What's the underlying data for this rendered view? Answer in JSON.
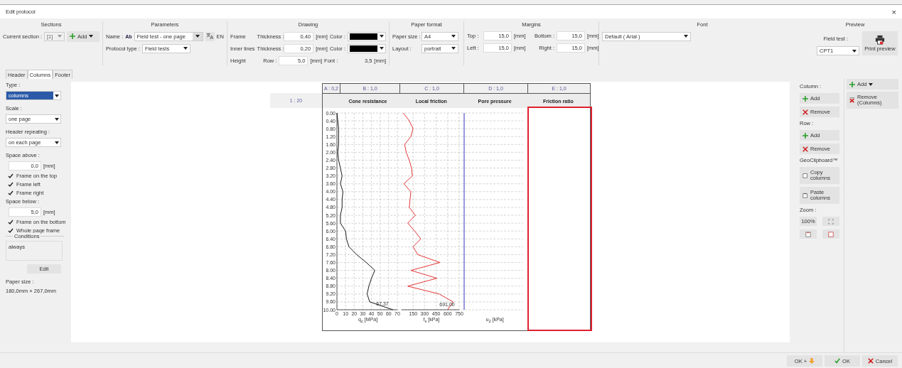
{
  "window": {
    "title": "Edit protocol",
    "close": "×"
  },
  "sections": {
    "title": "Sections",
    "current_label": "Current section :",
    "current_value": "[1]",
    "add": "Add"
  },
  "parameters": {
    "title": "Parameters",
    "name_label": "Name :",
    "name_badge": "Ab",
    "name_value": "Field test - one page",
    "language": "EN",
    "type_label": "Protocol type :",
    "type_value": "Field tests"
  },
  "drawing": {
    "title": "Drawing",
    "rows": [
      {
        "label": "Frame",
        "thickness_label": "Thickness :",
        "thickness": "0,40",
        "unit": "[mm]",
        "color_label": "Color :",
        "color": "#000000"
      },
      {
        "label": "Inner lines",
        "thickness_label": "Thickness :",
        "thickness": "0,20",
        "unit": "[mm]",
        "color_label": "Color :",
        "color": "#000000"
      }
    ],
    "height_label": "Height",
    "row_label": "Row :",
    "row": "5,0",
    "row_unit": "[mm]",
    "font_label": "Font :",
    "font": "3,5",
    "font_unit": "[mm]"
  },
  "paper_format": {
    "title": "Paper format",
    "size_label": "Paper size :",
    "size": "A4",
    "layout_label": "Layout :",
    "layout": "portrait"
  },
  "margins": {
    "title": "Margins",
    "fields": [
      {
        "label": "Top :",
        "value": "15,0",
        "unit": "[mm]"
      },
      {
        "label": "Bottom :",
        "value": "15,0",
        "unit": "[mm]"
      },
      {
        "label": "Left :",
        "value": "15,0",
        "unit": "[mm]"
      },
      {
        "label": "Right :",
        "value": "15,0",
        "unit": "[mm]"
      }
    ]
  },
  "font": {
    "title": "Font",
    "value": "Default ( Arial )"
  },
  "preview_group": {
    "title": "Preview",
    "field_test_label": "Field test :",
    "field_test": "CPT1",
    "print": "Print preview"
  },
  "tabs": [
    {
      "label": "Header",
      "selected": false
    },
    {
      "label": "Columns",
      "selected": true
    },
    {
      "label": "Footer",
      "selected": false
    }
  ],
  "left_panel": [
    {
      "kind": "label",
      "text": "Type :"
    },
    {
      "kind": "select",
      "value": "columns",
      "highlighted": true
    },
    {
      "kind": "label",
      "text": "Scale :"
    },
    {
      "kind": "select",
      "value": "one page",
      "highlighted": false
    },
    {
      "kind": "label",
      "text": "Header repeating :"
    },
    {
      "kind": "select",
      "value": "on each page",
      "highlighted": false
    },
    {
      "kind": "label",
      "text": "Space above :"
    },
    {
      "kind": "number",
      "value": "0,0",
      "unit": "[mm]"
    },
    {
      "kind": "checkbox",
      "label": "Frame on the top",
      "checked": true
    },
    {
      "kind": "checkbox",
      "label": "Frame left",
      "checked": true
    },
    {
      "kind": "checkbox",
      "label": "Frame right",
      "checked": true
    },
    {
      "kind": "label",
      "text": "Space below :"
    },
    {
      "kind": "number",
      "value": "5,0",
      "unit": "[mm]"
    },
    {
      "kind": "checkbox",
      "label": "Frame on the bottom",
      "checked": true
    },
    {
      "kind": "checkbox",
      "label": "Whole page frame",
      "checked": true
    },
    {
      "kind": "group",
      "title": "Conditions",
      "value": "always"
    },
    {
      "kind": "button",
      "label": "Edit"
    },
    {
      "kind": "label",
      "text": "Paper size :"
    },
    {
      "kind": "text",
      "text": "180,0mm × 267,0mm"
    }
  ],
  "preview": {
    "scale": "1 : 20",
    "column_tags": [
      "A : 0,2",
      "B : 1,0",
      "C : 1,0",
      "D : 1,0",
      "E : 1,0"
    ],
    "columns": [
      {
        "selected": false,
        "chart_data": {
          "type": "line",
          "orientation": "horizontal",
          "title": "Cone resistance",
          "xlabel": "q$_{c}$ [MPa]",
          "x": [
            0,
            0.4,
            0.8,
            1.2,
            1.6,
            2.0,
            2.4,
            2.8,
            3.2,
            3.6,
            4.0,
            4.4,
            4.8,
            5.2,
            5.6,
            6.0,
            6.4,
            6.8,
            7.2,
            7.6,
            8.0,
            8.4,
            8.8,
            9.2,
            9.6,
            10.0
          ],
          "xlim": [
            0,
            70
          ],
          "ylim": [
            10,
            0
          ],
          "yticks": [
            {
              "value": 0,
              "label": "0.00"
            },
            {
              "value": 0.4,
              "label": "0.40"
            },
            {
              "value": 0.8,
              "label": "0.80"
            },
            {
              "value": 1.2,
              "label": "1.20"
            },
            {
              "value": 1.6,
              "label": "1.60"
            },
            {
              "value": 2.0,
              "label": "2.00"
            },
            {
              "value": 2.4,
              "label": "2.40"
            },
            {
              "value": 2.8,
              "label": "2.80"
            },
            {
              "value": 3.2,
              "label": "3.20"
            },
            {
              "value": 3.6,
              "label": "3.60"
            },
            {
              "value": 4.0,
              "label": "4.00"
            },
            {
              "value": 4.4,
              "label": "4.40"
            },
            {
              "value": 4.8,
              "label": "4.80"
            },
            {
              "value": 5.2,
              "label": "5.20"
            },
            {
              "value": 5.6,
              "label": "5.60"
            },
            {
              "value": 6.0,
              "label": "6.00"
            },
            {
              "value": 6.4,
              "label": "6.40"
            },
            {
              "value": 6.8,
              "label": "6.80"
            },
            {
              "value": 7.2,
              "label": "7.20"
            },
            {
              "value": 7.6,
              "label": "7.60"
            },
            {
              "value": 8.0,
              "label": "8.00"
            },
            {
              "value": 8.4,
              "label": "8.40"
            },
            {
              "value": 8.8,
              "label": "8.80"
            },
            {
              "value": 9.2,
              "label": "9.20"
            },
            {
              "value": 9.6,
              "label": "9.60"
            },
            {
              "value": 10.0,
              "label": "10.00"
            }
          ],
          "xticks": [
            0,
            10,
            20,
            30,
            40,
            50,
            60,
            70
          ],
          "series": [
            {
              "color": "#000000",
              "values": [
                0,
                1,
                2,
                2,
                2,
                1,
                2,
                4,
                6,
                4,
                7,
                6,
                6,
                4,
                4,
                10,
                11,
                14,
                23,
                34,
                44,
                40,
                37,
                35,
                38,
                65
              ]
            }
          ],
          "annotations": [
            "67,37"
          ]
        }
      },
      {
        "selected": false,
        "chart_data": {
          "type": "line",
          "orientation": "horizontal",
          "title": "Local friction",
          "xlabel": "f$_{s}$ [kPa]",
          "x": [
            0,
            0.4,
            0.8,
            1.2,
            1.6,
            2.0,
            2.4,
            2.8,
            3.2,
            3.6,
            4.0,
            4.4,
            4.8,
            5.2,
            5.6,
            6.0,
            6.4,
            6.8,
            7.2,
            7.6,
            8.0,
            8.4,
            8.8,
            9.2,
            9.6,
            10.0
          ],
          "xlim": [
            0,
            750
          ],
          "ylim": [
            10,
            0
          ],
          "xticks": [
            150,
            300,
            450,
            600,
            750
          ],
          "series": [
            {
              "color": "#e02020",
              "values": [
                20,
                100,
                150,
                120,
                40,
                60,
                100,
                130,
                140,
                30,
                120,
                110,
                100,
                180,
                80,
                170,
                250,
                150,
                210,
                500,
                120,
                460,
                80,
                490,
                670,
                600
              ]
            }
          ],
          "annotations": [
            "691,00"
          ]
        }
      },
      {
        "title": "Pore pressure",
        "selected": false,
        "axis_label": "u$_{2}$ [kPa]"
      },
      {
        "title": "Friction ratio",
        "selected": true
      }
    ]
  },
  "right_panel": [
    {
      "kind": "label",
      "text": "Column :"
    },
    {
      "kind": "add",
      "label": "Add"
    },
    {
      "kind": "remove",
      "label": "Remove"
    },
    {
      "kind": "label",
      "text": "Row :"
    },
    {
      "kind": "add",
      "label": "Add"
    },
    {
      "kind": "remove",
      "label": "Remove"
    },
    {
      "kind": "label",
      "text": "GeoClipboard™"
    },
    {
      "kind": "copy",
      "label": "Copy columns"
    },
    {
      "kind": "paste",
      "label": "Paste columns"
    },
    {
      "kind": "label",
      "text": "Zoom :"
    },
    {
      "kind": "zoom",
      "label": "100%"
    }
  ],
  "side_actions": {
    "add": "Add",
    "remove": "Remove (Columns)"
  },
  "footer_buttons": [
    {
      "kind": "ok_plus",
      "label": "OK +"
    },
    {
      "kind": "ok",
      "label": "OK"
    },
    {
      "kind": "cancel",
      "label": "Cancel"
    }
  ]
}
